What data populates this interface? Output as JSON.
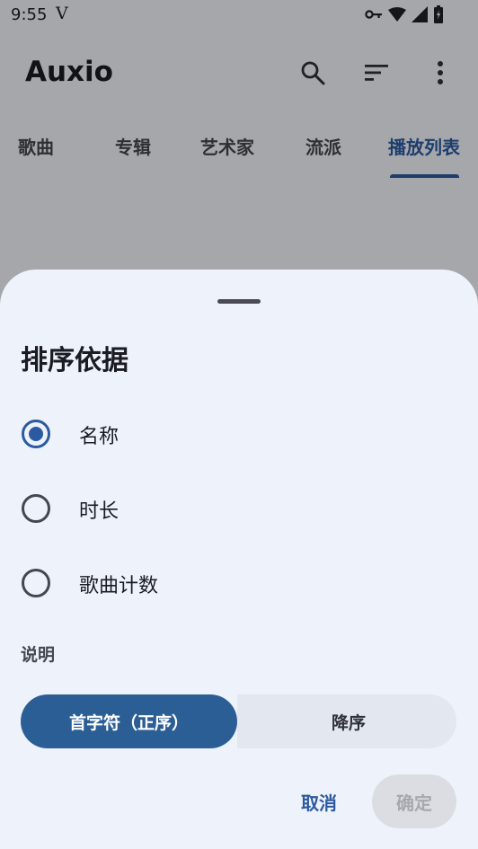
{
  "status_bar": {
    "time": "9:55",
    "notification": "V",
    "icons": [
      "vpn-key-icon",
      "wifi-icon",
      "signal-icon",
      "battery-icon"
    ]
  },
  "app_bar": {
    "title": "Auxio",
    "actions": [
      "search-icon",
      "sort-icon",
      "more-vert-icon"
    ]
  },
  "tabs": [
    {
      "label": "歌曲",
      "active": false
    },
    {
      "label": "专辑",
      "active": false
    },
    {
      "label": "艺术家",
      "active": false
    },
    {
      "label": "流派",
      "active": false
    },
    {
      "label": "播放列表",
      "active": true
    }
  ],
  "sort_sheet": {
    "title": "排序依据",
    "options": [
      {
        "label": "名称",
        "checked": true
      },
      {
        "label": "时长",
        "checked": false
      },
      {
        "label": "歌曲计数",
        "checked": false
      }
    ],
    "direction_label": "说明",
    "direction": {
      "ascending": "首字符（正序）",
      "descending": "降序",
      "selected": "ascending"
    },
    "cancel_label": "取消",
    "confirm_label": "确定"
  },
  "colors": {
    "accent": "#2c5aa0",
    "selected_segment": "#2c5e96",
    "sheet_background": "#eef2fb"
  }
}
